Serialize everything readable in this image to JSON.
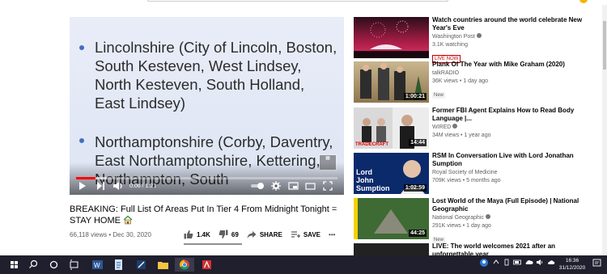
{
  "player": {
    "slide_lines_1": "Lincolnshire (City of Lincoln, Boston, South Kesteven, West Lindsey, North Kesteven, South Holland, East Lindsey)",
    "slide_lines_2": "Northamptonshire (Corby, Daventry, East Northamptonshire, Kettering, Northampton, South",
    "time_current": "0:06",
    "time_total": "1:21",
    "time_display": "0:06 / 1:21",
    "progress_fraction": 0.074
  },
  "video": {
    "title": "BREAKING: Full List Of Areas Put In Tier 4 From Midnight Tonight = STAY HOME",
    "views": "66,118 views",
    "date": "Dec 30, 2020",
    "views_date": "66,118 views • Dec 30, 2020",
    "likes": "1.4K",
    "dislikes": "69",
    "share_label": "SHARE",
    "save_label": "SAVE",
    "more_label": "•••"
  },
  "recommendations": [
    {
      "title": "Watch countries around the world celebrate New Year's Eve",
      "channel": "Washington Post",
      "views": "3.1K watching",
      "badge": "LIVE NOW",
      "duration": ""
    },
    {
      "title": "Plank Of The Year with Mike Graham (2020)",
      "channel": "talkRADIO",
      "views": "36K views • 1 day ago",
      "badge": "New",
      "duration": "1:00:21"
    },
    {
      "title": "Former FBI Agent Explains How to Read Body Language |...",
      "channel": "WIRED",
      "views": "34M views • 1 year ago",
      "badge": "",
      "duration": "14:44"
    },
    {
      "title": "RSM In Conversation Live with Lord Jonathan Sumption",
      "channel": "Royal Society of Medicine",
      "views": "709K views • 5 months ago",
      "badge": "",
      "duration": "1:02:59"
    },
    {
      "title": "Lost World of the Maya (Full Episode) | National Geographic",
      "channel": "National Geographic",
      "views": "291K views • 1 day ago",
      "badge": "New",
      "duration": "44:25"
    },
    {
      "title": "LIVE: The world welcomes 2021 after an unforgettable year",
      "channel": "",
      "views": "",
      "badge": "",
      "duration": ""
    }
  ],
  "thumb_text": {
    "tradecraft": "TRADECRAFT",
    "lord_john": "Lord John Sumption"
  },
  "taskbar": {
    "time": "16:36",
    "date": "31/12/2020"
  },
  "colors": {
    "accent_red": "#ff0000",
    "taskbar_bg": "#1f1f2e",
    "bullet_blue": "#3f6fc0"
  }
}
